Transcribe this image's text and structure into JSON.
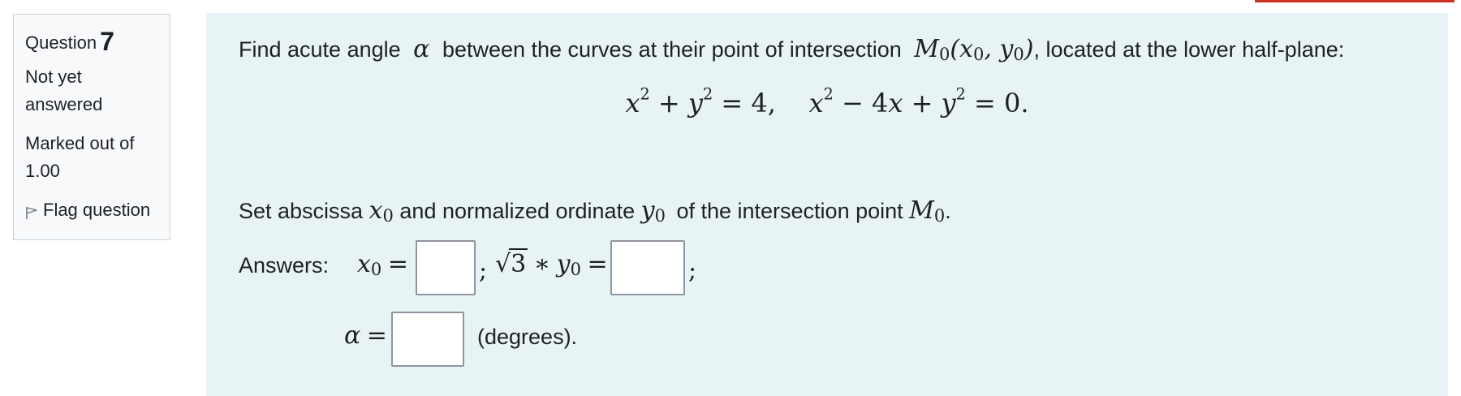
{
  "question_info": {
    "label": "Question",
    "number": "7",
    "state_line1": "Not yet",
    "state_line2": "answered",
    "grade_line1": "Marked out of",
    "grade_line2": "1.00",
    "flag_label": "Flag question"
  },
  "question_text": {
    "intro_part1": "Find acute angle",
    "alpha": "α",
    "intro_part2": "between the curves at their point of intersection",
    "point_name": "M",
    "intro_part3": ", located at the lower half-plane:",
    "instruction_part1": "Set abscissa",
    "instruction_part2": "and normalized ordinate",
    "instruction_part3": "of the intersection point",
    "answers_label": "Answers:",
    "degrees_label": "(degrees)."
  },
  "answers": {
    "x0_value": "",
    "y0_value": "",
    "alpha_value": ""
  },
  "colors": {
    "content_bg": "#e7f3f5",
    "info_bg": "#f8f9fa",
    "accent": "#ca3120"
  }
}
